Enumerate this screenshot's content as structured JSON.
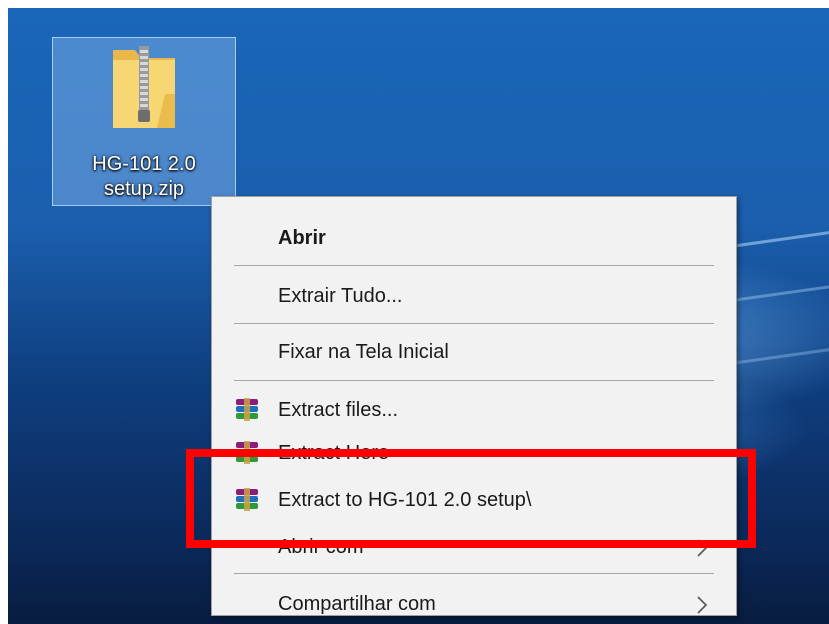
{
  "desktop": {
    "file_icon": {
      "label_line1": "HG-101 2.0",
      "label_line2": "setup.zip",
      "icon": "zip-folder-icon"
    }
  },
  "context_menu": {
    "items": [
      {
        "label": "Abrir",
        "bold": true
      },
      {
        "label": "Extrair Tudo..."
      },
      {
        "label": "Fixar na Tela Inicial"
      },
      {
        "label": "Extract files...",
        "icon": "winrar-icon"
      },
      {
        "label": "Extract Here",
        "icon": "winrar-icon"
      },
      {
        "label": "Extract to HG-101 2.0 setup\\",
        "icon": "winrar-icon"
      },
      {
        "label": "Abrir com",
        "submenu": true
      },
      {
        "label": "Compartilhar com",
        "submenu": true
      }
    ]
  },
  "annotation": {
    "highlight_color": "#ff0000",
    "highlights_item": "Extract to HG-101 2.0 setup\\"
  }
}
